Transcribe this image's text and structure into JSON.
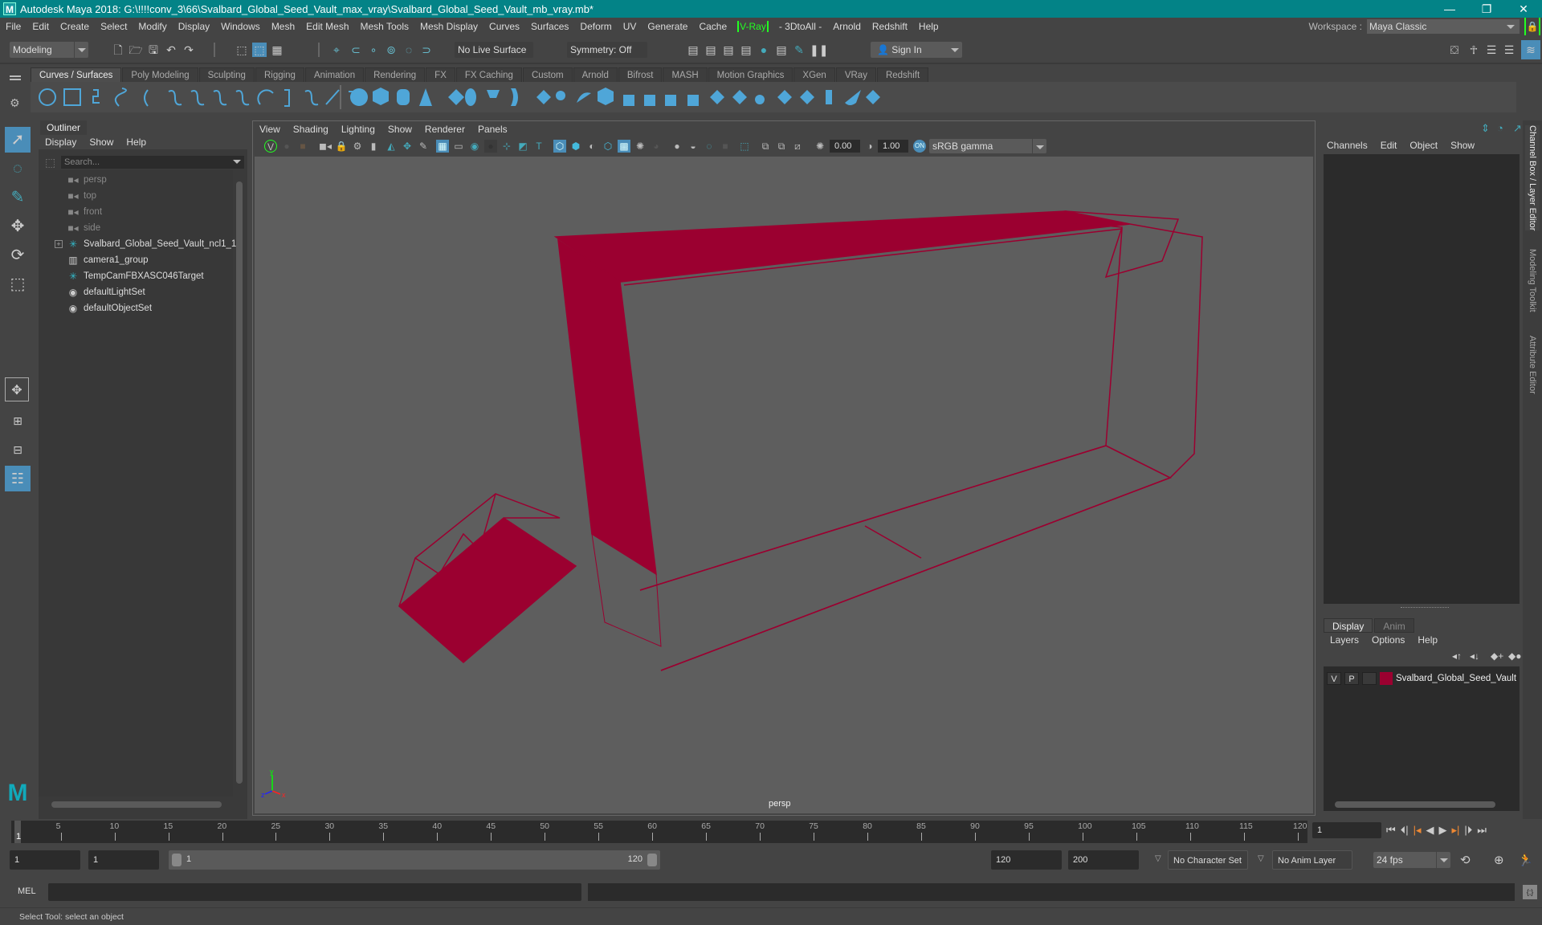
{
  "titlebar": {
    "title": "Autodesk Maya 2018: G:\\!!!!conv_3\\66\\Svalbard_Global_Seed_Vault_max_vray\\Svalbard_Global_Seed_Vault_mb_vray.mb*",
    "app_icon": "maya-logo-icon",
    "minimize": "—",
    "restore": "❐",
    "close": "✕"
  },
  "menubar": {
    "items": [
      "File",
      "Edit",
      "Create",
      "Select",
      "Modify",
      "Display",
      "Windows",
      "Mesh",
      "Edit Mesh",
      "Mesh Tools",
      "Mesh Display",
      "Curves",
      "Surfaces",
      "Deform",
      "UV",
      "Generate",
      "Cache",
      "V-Ray",
      "- 3DtoAll -",
      "Arnold",
      "Redshift",
      "Help"
    ],
    "workspace_label": "Workspace :",
    "workspace_value": "Maya Classic"
  },
  "statusline": {
    "mode": "Modeling",
    "live_surface": "No Live Surface",
    "symmetry": "Symmetry: Off",
    "sign_in": "Sign In"
  },
  "shelf": {
    "tabs": [
      "Curves / Surfaces",
      "Poly Modeling",
      "Sculpting",
      "Rigging",
      "Animation",
      "Rendering",
      "FX",
      "FX Caching",
      "Custom",
      "Arnold",
      "Bifrost",
      "MASH",
      "Motion Graphics",
      "XGen",
      "VRay",
      "Redshift"
    ],
    "active_tab": "Curves / Surfaces"
  },
  "outliner": {
    "title": "Outliner",
    "menus": [
      "Display",
      "Show",
      "Help"
    ],
    "search_placeholder": "Search...",
    "items": [
      {
        "label": "persp",
        "icon": "camera-icon",
        "dim": true
      },
      {
        "label": "top",
        "icon": "camera-icon",
        "dim": true
      },
      {
        "label": "front",
        "icon": "camera-icon",
        "dim": true
      },
      {
        "label": "side",
        "icon": "camera-icon",
        "dim": true
      },
      {
        "label": "Svalbard_Global_Seed_Vault_ncl1_1",
        "icon": "transform-icon",
        "dim": false,
        "expandable": true
      },
      {
        "label": "camera1_group",
        "icon": "group-icon",
        "dim": false
      },
      {
        "label": "TempCamFBXASC046Target",
        "icon": "transform-icon",
        "dim": false
      },
      {
        "label": "defaultLightSet",
        "icon": "set-icon",
        "dim": false
      },
      {
        "label": "defaultObjectSet",
        "icon": "set-icon",
        "dim": false
      }
    ]
  },
  "viewport": {
    "menus": [
      "View",
      "Shading",
      "Lighting",
      "Show",
      "Renderer",
      "Panels"
    ],
    "exposure": "0.00",
    "gamma": "1.00",
    "color_space": "sRGB gamma",
    "camera_label": "persp",
    "wire_color": "#9b0030",
    "axis": {
      "x": "x",
      "y": "y",
      "z": "z"
    }
  },
  "channel_box": {
    "menus": [
      "Channels",
      "Edit",
      "Object",
      "Show"
    ]
  },
  "layer_editor": {
    "tabs": [
      "Display",
      "Anim"
    ],
    "active_tab": "Display",
    "menus": [
      "Layers",
      "Options",
      "Help"
    ],
    "layers": [
      {
        "v": "V",
        "p": "P",
        "name": "Svalbard_Global_Seed_Vault",
        "color": "#9b0030"
      }
    ]
  },
  "side_tabs": [
    "Channel Box / Layer Editor",
    "Modeling Toolkit",
    "Attribute Editor"
  ],
  "timeline": {
    "ticks": [
      5,
      10,
      15,
      20,
      25,
      30,
      35,
      40,
      45,
      50,
      55,
      60,
      65,
      70,
      75,
      80,
      85,
      90,
      95,
      100,
      105,
      110,
      115,
      120
    ],
    "start": 1,
    "end": 120,
    "current_frame": "1",
    "current_marker": "1"
  },
  "range": {
    "start": "1",
    "anim_start": "1",
    "slider_start": "1",
    "slider_end": "120",
    "playback_end": "120",
    "anim_end": "200",
    "character_set": "No Character Set",
    "anim_layer": "No Anim Layer",
    "fps": "24 fps"
  },
  "command": {
    "label": "MEL"
  },
  "help_line": "Select Tool: select an object"
}
